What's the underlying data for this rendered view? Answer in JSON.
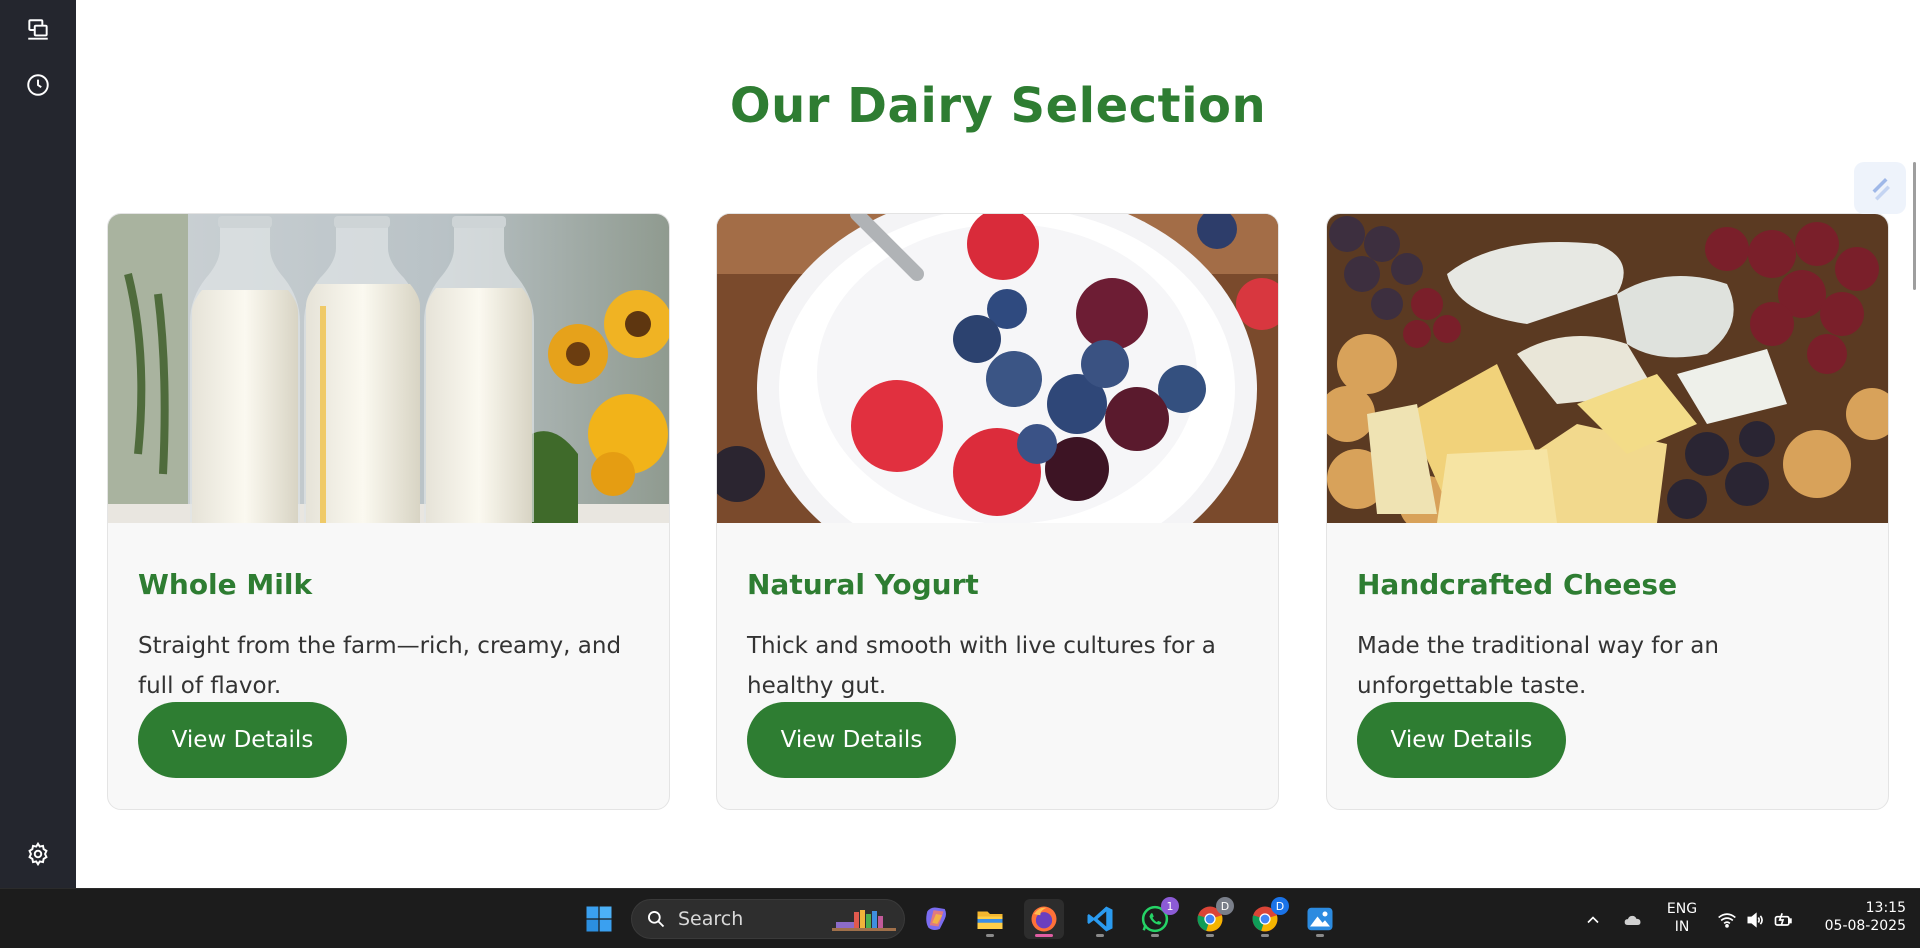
{
  "sidebar": {
    "icons": [
      "devices-icon",
      "history-icon",
      "settings-icon"
    ]
  },
  "main": {
    "section_title": "Our Dairy Selection",
    "cards": [
      {
        "title": "Whole Milk",
        "description": "Straight from the farm—rich, creamy, and full of flavor.",
        "button_label": "View Details",
        "image": "milk-bottles-photo"
      },
      {
        "title": "Natural Yogurt",
        "description": "Thick and smooth with live cultures for a healthy gut.",
        "button_label": "View Details",
        "image": "yogurt-berries-photo"
      },
      {
        "title": "Handcrafted Cheese",
        "description": "Made the traditional way for an unforgettable taste.",
        "button_label": "View Details",
        "image": "cheese-platter-photo"
      }
    ]
  },
  "taskbar": {
    "search_label": "Search",
    "apps": [
      "windows-start-icon",
      "copilot-icon",
      "file-explorer-icon",
      "firefox-icon",
      "vscode-icon",
      "whatsapp-icon",
      "chrome-icon",
      "chrome-profile-icon",
      "photos-icon"
    ],
    "whatsapp_badge": "1",
    "chrome_badge": "D",
    "chrome_profile_badge": "D",
    "language_line1": "ENG",
    "language_line2": "IN",
    "time": "13:15",
    "date": "05-08-2025"
  },
  "colors": {
    "accent_green": "#2e7d32",
    "sidebar_bg": "#24262e",
    "taskbar_bg": "#1c1c1c",
    "card_bg": "#f8f8f8"
  }
}
